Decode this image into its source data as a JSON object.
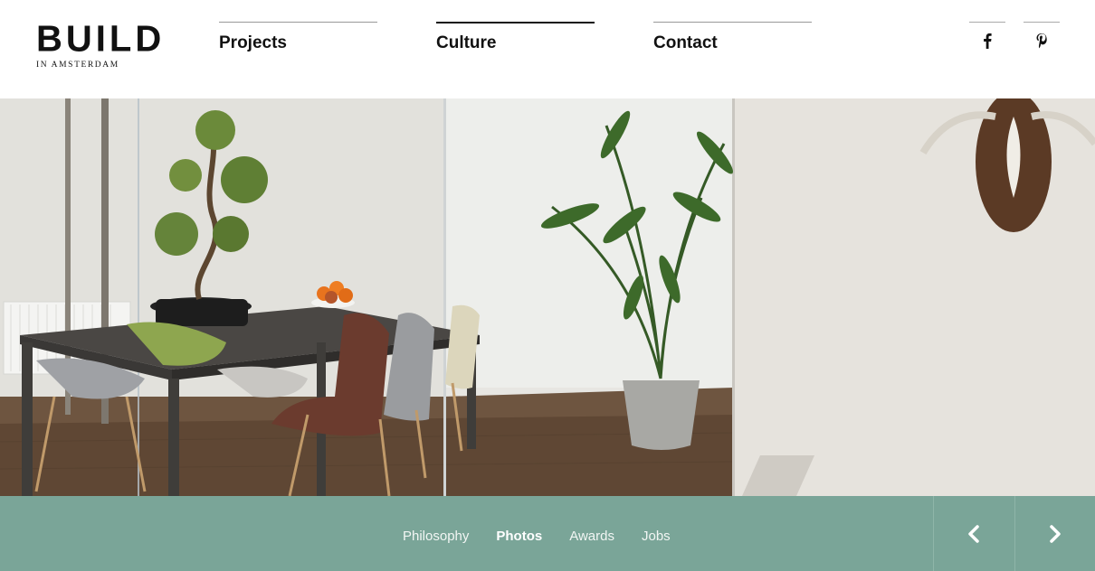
{
  "brand": {
    "logo_main": "BUILD",
    "logo_sub": "IN AMSTERDAM"
  },
  "nav": {
    "items": [
      {
        "label": "Projects",
        "active": false
      },
      {
        "label": "Culture",
        "active": true
      },
      {
        "label": "Contact",
        "active": false
      }
    ]
  },
  "social": {
    "facebook_icon": "facebook-icon",
    "pinterest_icon": "pinterest-icon"
  },
  "hero": {
    "image": "office-interior-photo",
    "icon_prev": "chevron-left-icon",
    "icon_next": "chevron-right-icon"
  },
  "subnav": {
    "items": [
      {
        "label": "Philosophy",
        "active": false
      },
      {
        "label": "Photos",
        "active": true
      },
      {
        "label": "Awards",
        "active": false
      },
      {
        "label": "Jobs",
        "active": false
      }
    ]
  },
  "colors": {
    "accent": "#7aa598",
    "text": "#111111",
    "background": "#ffffff"
  }
}
